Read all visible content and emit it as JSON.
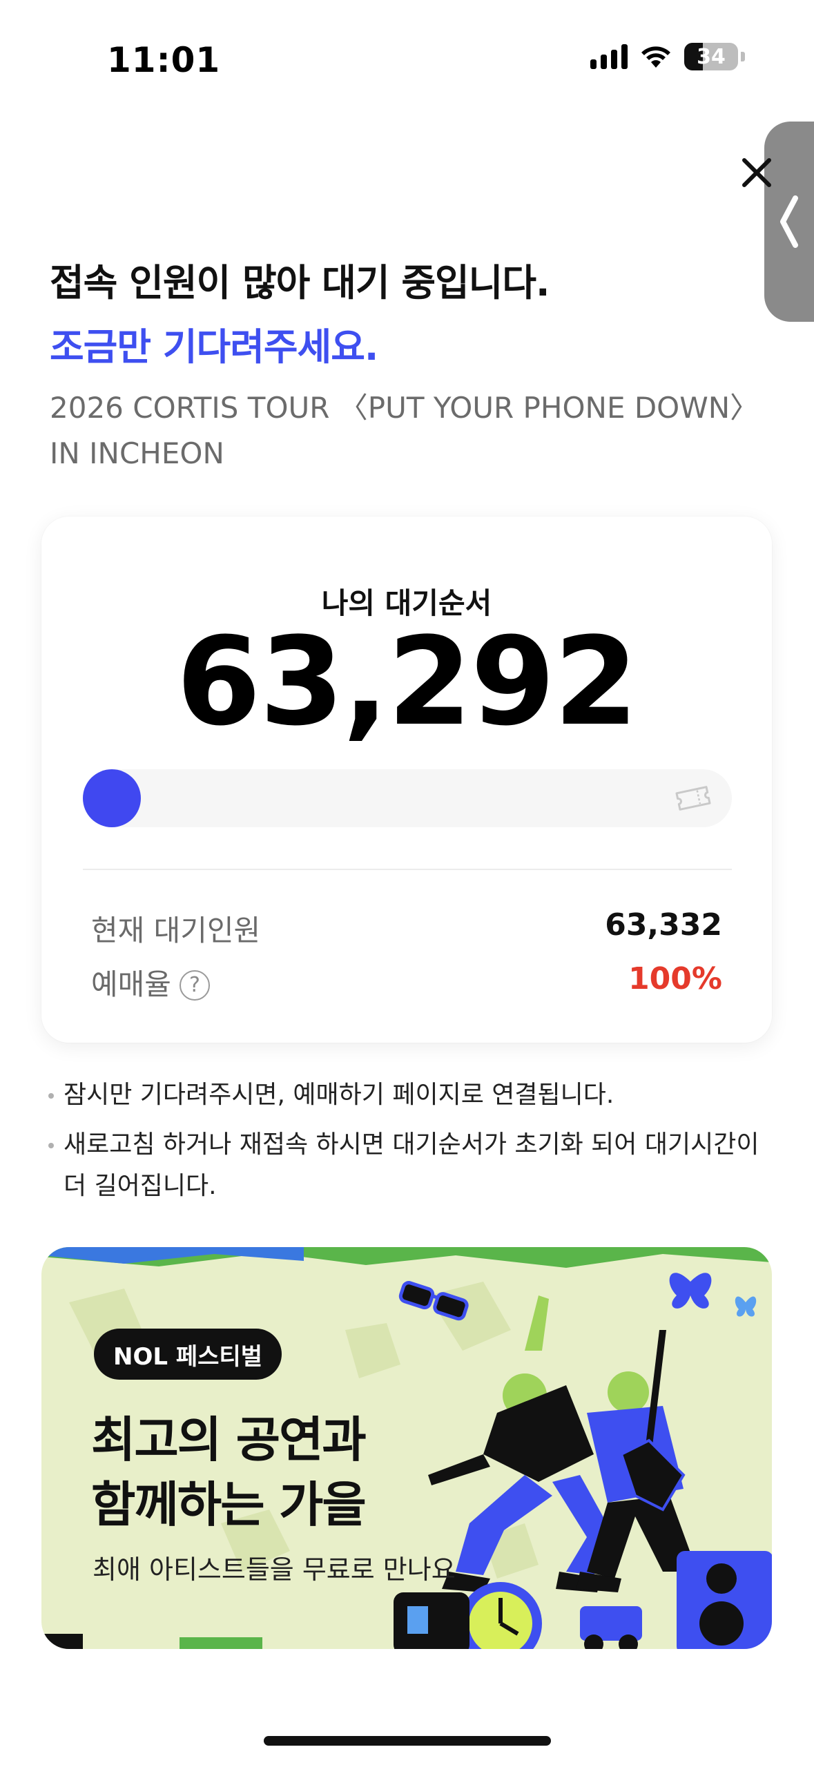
{
  "status_bar": {
    "time": "11:01",
    "battery": "34"
  },
  "header": {
    "headline": "접속 인원이 많아 대기 중입니다.",
    "subhead": "조금만 기다려주세요.",
    "event_title": "2026 CORTIS TOUR 〈PUT YOUR PHONE DOWN〉 IN INCHEON"
  },
  "queue": {
    "label": "나의 대기순서",
    "position": "63,292",
    "progress_fraction": 0.0,
    "rows": [
      {
        "label": "현재 대기인원",
        "value": "63,332"
      },
      {
        "label": "예매율",
        "value": "100%"
      }
    ],
    "help_symbol": "?"
  },
  "notices": [
    "잠시만 기다려주시면, 예매하기 페이지로 연결됩니다.",
    "새로고침 하거나 재접속 하시면 대기순서가 초기화 되어 대기시간이 더 길어집니다."
  ],
  "banner": {
    "badge": "NOL 페스티벌",
    "title_line1": "최고의 공연과",
    "title_line2": "함께하는 가을",
    "subtitle": "최애 아티스트들을 무료로 만나요"
  },
  "colors": {
    "accent": "#3e4ff0",
    "progress_dot": "#4048f0",
    "rate_red": "#e53a2b",
    "banner_bg": "#e8efc9"
  },
  "icons": [
    "signal-icon",
    "wifi-icon",
    "battery-icon",
    "chevron-left-icon",
    "close-icon",
    "ticket-icon",
    "help-icon"
  ]
}
